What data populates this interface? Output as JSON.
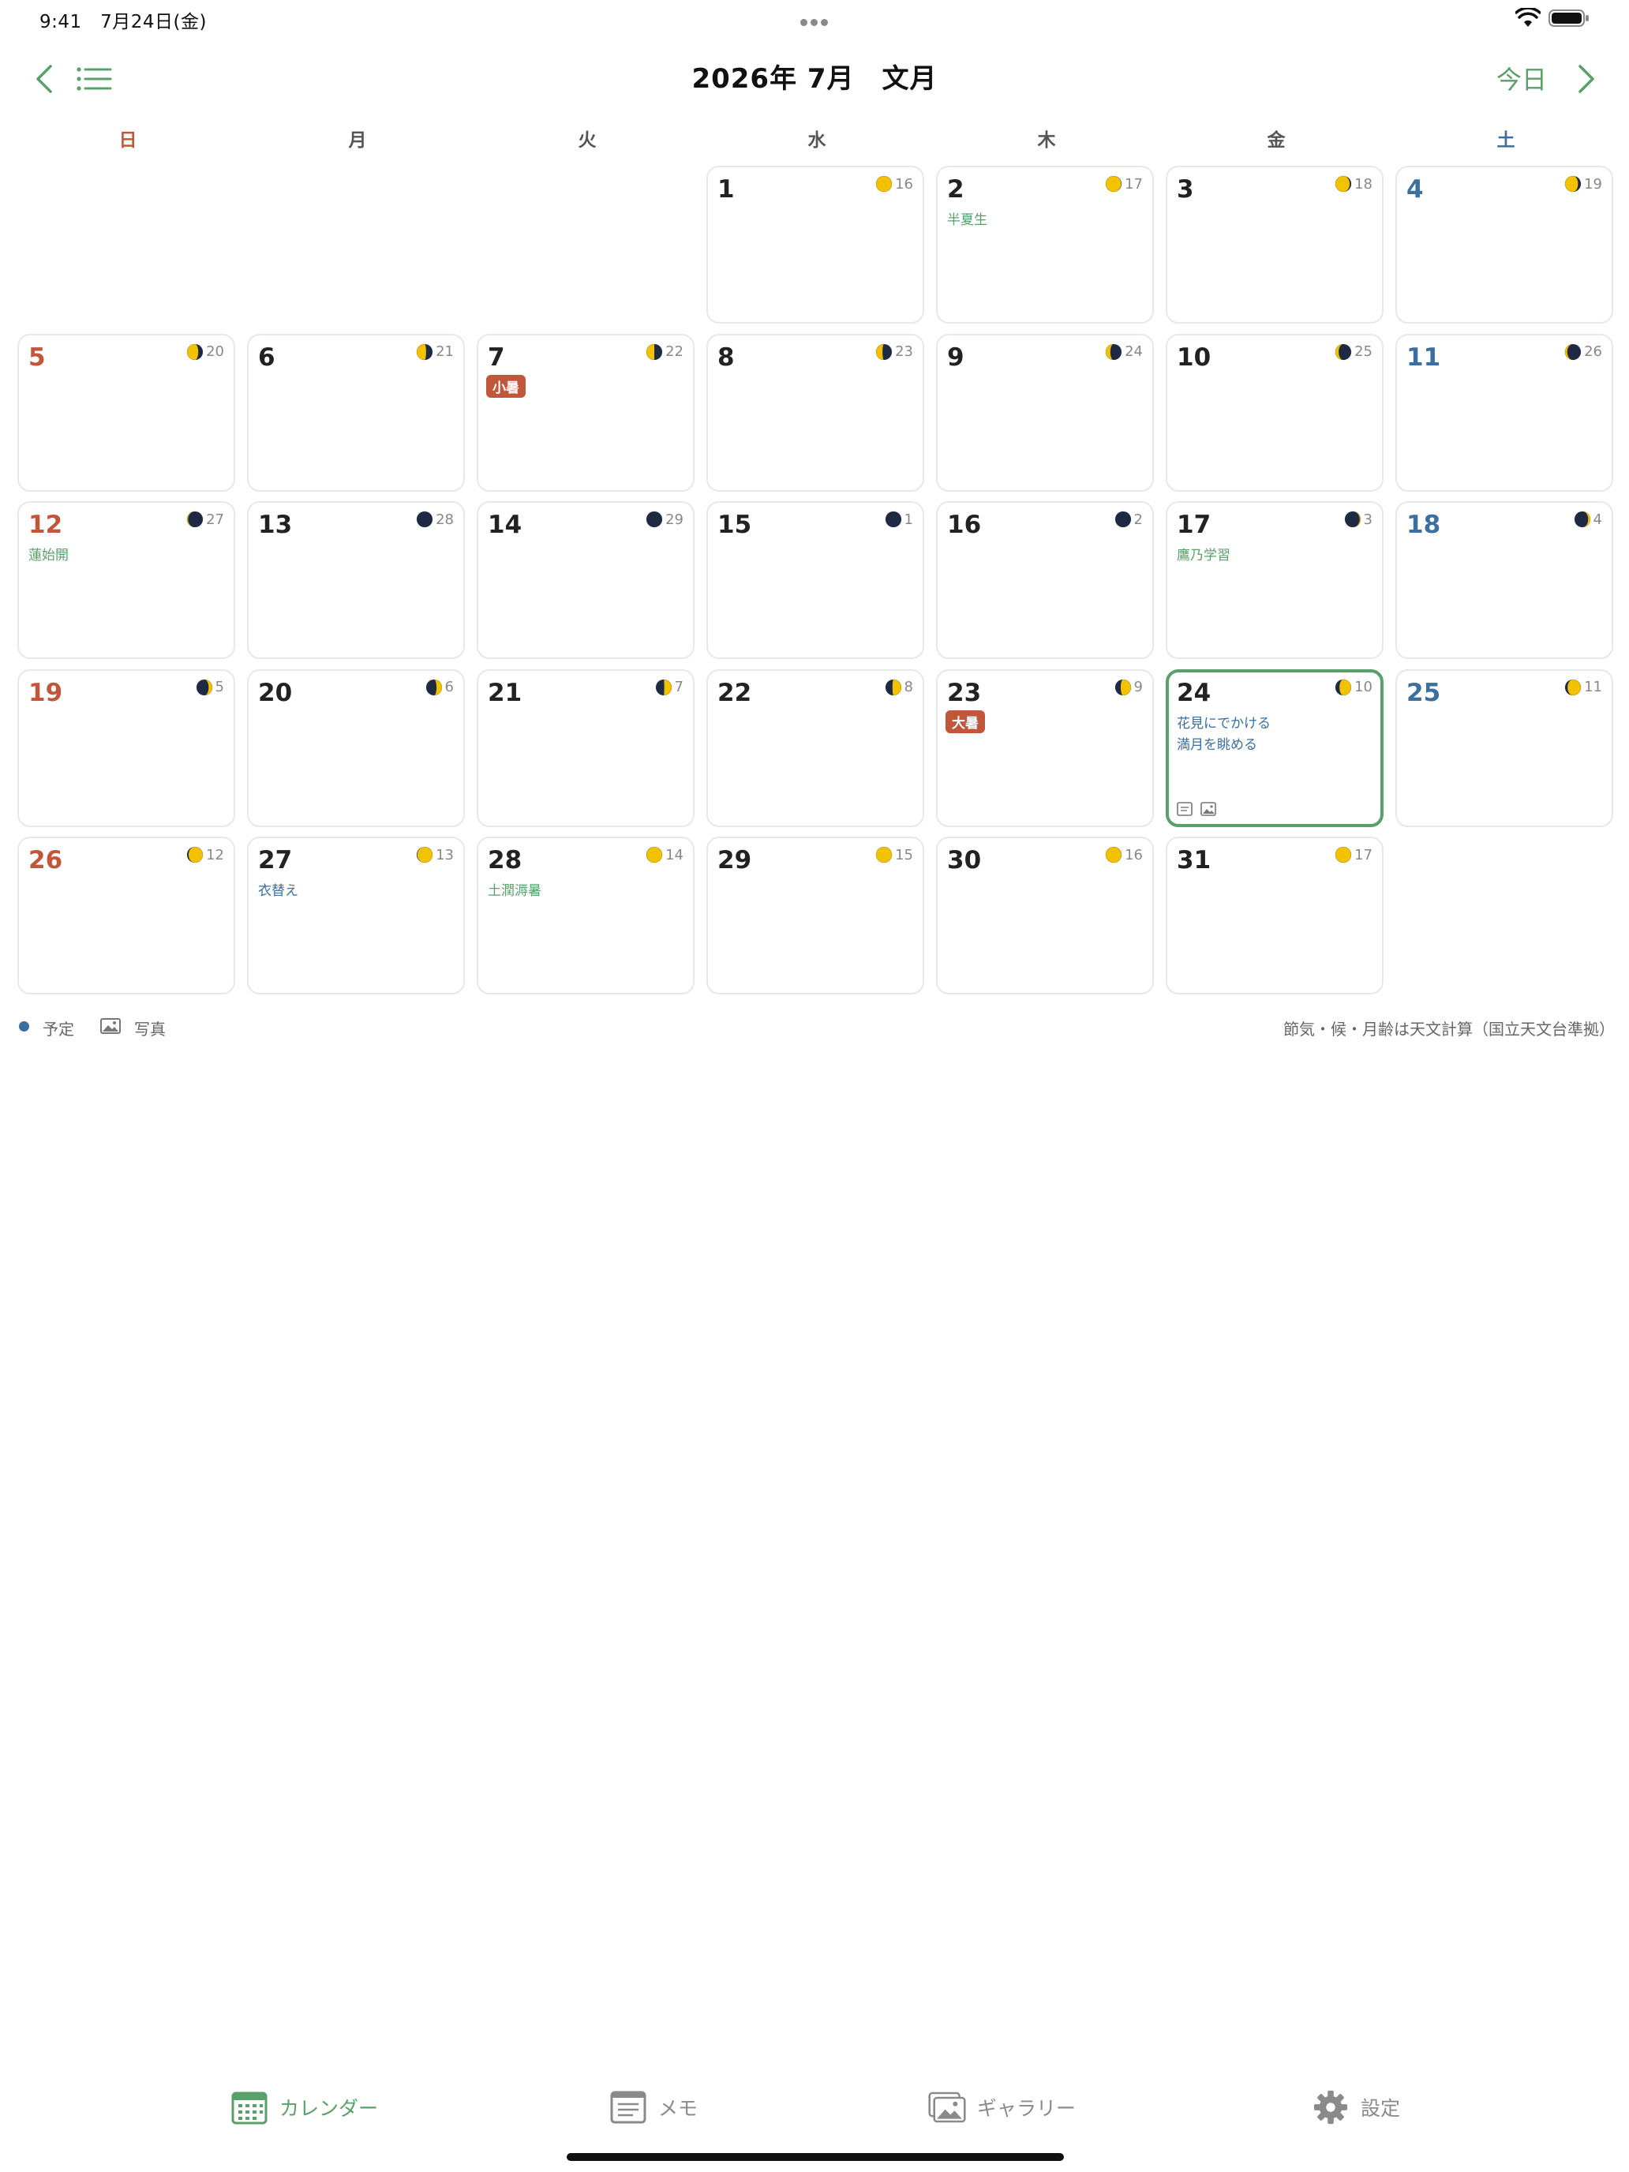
{
  "status": {
    "time": "9:41",
    "date": "7月24日(金)"
  },
  "header": {
    "title": "2026年 7月　文月",
    "today_label": "今日"
  },
  "weekdays": [
    "日",
    "月",
    "火",
    "水",
    "木",
    "金",
    "土"
  ],
  "colors": {
    "accent": "#5aa06b",
    "sunday": "#c0573a",
    "saturday": "#3a6f9f",
    "moon_light": "#f2c200",
    "moon_dark": "#1e2a44",
    "badge": "#c0573a"
  },
  "calendar": {
    "days": [
      {
        "day": "1",
        "moon_age": "16",
        "moon_phase": 0.5
      },
      {
        "day": "2",
        "moon_age": "17",
        "moon_phase": 0.55,
        "event": "半夏生",
        "event_color": "green"
      },
      {
        "day": "3",
        "moon_age": "18",
        "moon_phase": 0.6
      },
      {
        "day": "4",
        "moon_age": "19",
        "moon_phase": 0.64
      },
      {
        "day": "5",
        "moon_age": "20",
        "moon_phase": 0.68
      },
      {
        "day": "6",
        "moon_age": "21",
        "moon_phase": 0.72
      },
      {
        "day": "7",
        "moon_age": "22",
        "moon_phase": 0.75,
        "badge": "小暑"
      },
      {
        "day": "8",
        "moon_age": "23",
        "moon_phase": 0.78
      },
      {
        "day": "9",
        "moon_age": "24",
        "moon_phase": 0.82
      },
      {
        "day": "10",
        "moon_age": "25",
        "moon_phase": 0.85
      },
      {
        "day": "11",
        "moon_age": "26",
        "moon_phase": 0.88
      },
      {
        "day": "12",
        "moon_age": "27",
        "moon_phase": 0.92,
        "event": "蓮始開",
        "event_color": "green"
      },
      {
        "day": "13",
        "moon_age": "28",
        "moon_phase": 0.96
      },
      {
        "day": "14",
        "moon_age": "29",
        "moon_phase": 0.98
      },
      {
        "day": "15",
        "moon_age": "1",
        "moon_phase": 0.0
      },
      {
        "day": "16",
        "moon_age": "2",
        "moon_phase": 0.04
      },
      {
        "day": "17",
        "moon_age": "3",
        "moon_phase": 0.08,
        "event": "鷹乃学習",
        "event_color": "green"
      },
      {
        "day": "18",
        "moon_age": "4",
        "moon_phase": 0.12
      },
      {
        "day": "19",
        "moon_age": "5",
        "moon_phase": 0.16
      },
      {
        "day": "20",
        "moon_age": "6",
        "moon_phase": 0.2
      },
      {
        "day": "21",
        "moon_age": "7",
        "moon_phase": 0.24
      },
      {
        "day": "22",
        "moon_age": "8",
        "moon_phase": 0.27
      },
      {
        "day": "23",
        "moon_age": "9",
        "moon_phase": 0.3,
        "badge": "大暑"
      },
      {
        "day": "24",
        "moon_age": "10",
        "moon_phase": 0.33,
        "today": true,
        "events": [
          "花見にでかける",
          "満月を眺める"
        ],
        "event_color": "blue",
        "has_memo": true,
        "has_photo": true
      },
      {
        "day": "25",
        "moon_age": "11",
        "moon_phase": 0.37
      },
      {
        "day": "26",
        "moon_age": "12",
        "moon_phase": 0.4
      },
      {
        "day": "27",
        "moon_age": "13",
        "moon_phase": 0.44,
        "event": "衣替え",
        "event_color": "blue"
      },
      {
        "day": "28",
        "moon_age": "14",
        "moon_phase": 0.47,
        "event": "土潤溽暑",
        "event_color": "green"
      },
      {
        "day": "29",
        "moon_age": "15",
        "moon_phase": 0.5
      },
      {
        "day": "30",
        "moon_age": "16",
        "moon_phase": 0.5
      },
      {
        "day": "31",
        "moon_age": "17",
        "moon_phase": 0.5
      }
    ]
  },
  "legend": {
    "schedule": "予定",
    "photo": "写真",
    "note": "節気・候・月齢は天文計算（国立天文台準拠）"
  },
  "tabs": [
    {
      "label": "カレンダー",
      "icon": "calendar-icon",
      "active": true
    },
    {
      "label": "メモ",
      "icon": "memo-icon",
      "active": false
    },
    {
      "label": "ギャラリー",
      "icon": "gallery-icon",
      "active": false
    },
    {
      "label": "設定",
      "icon": "gear-icon",
      "active": false
    }
  ]
}
